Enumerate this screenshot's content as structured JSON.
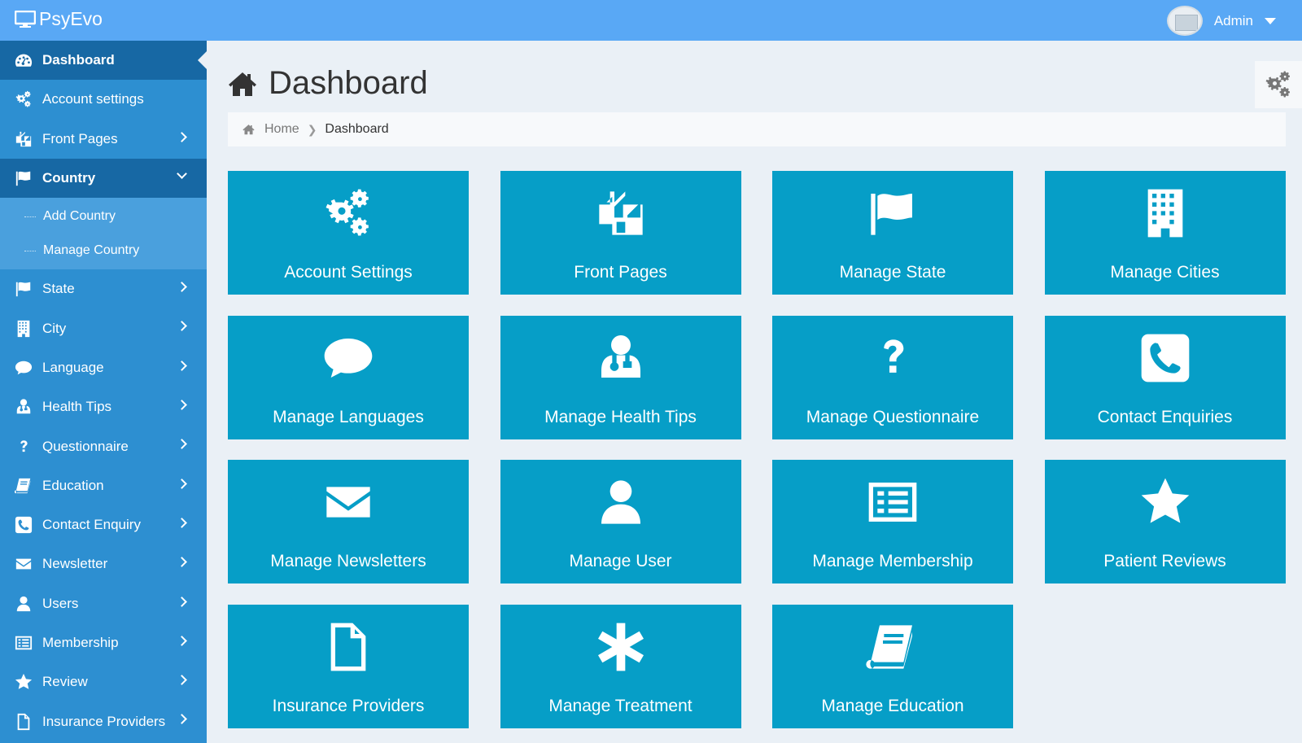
{
  "app": {
    "brand": "PsyEvo",
    "user": "Admin"
  },
  "sidebar": {
    "items": [
      {
        "label": "Dashboard"
      },
      {
        "label": "Account settings"
      },
      {
        "label": "Front Pages"
      },
      {
        "label": "Country"
      },
      {
        "label": "State"
      },
      {
        "label": "City"
      },
      {
        "label": "Language"
      },
      {
        "label": "Health Tips"
      },
      {
        "label": "Questionnaire"
      },
      {
        "label": "Education"
      },
      {
        "label": "Contact Enquiry"
      },
      {
        "label": "Newsletter"
      },
      {
        "label": "Users"
      },
      {
        "label": "Membership"
      },
      {
        "label": "Review"
      },
      {
        "label": "Insurance Providers"
      }
    ],
    "country_sub": [
      {
        "label": "Add Country"
      },
      {
        "label": "Manage Country"
      }
    ]
  },
  "page": {
    "title": "Dashboard"
  },
  "breadcrumb": {
    "home": "Home",
    "current": "Dashboard"
  },
  "tiles": [
    {
      "label": "Account Settings",
      "icon": "gears-icon"
    },
    {
      "label": "Front Pages",
      "icon": "copy-icon"
    },
    {
      "label": "Manage State",
      "icon": "flag-icon"
    },
    {
      "label": "Manage Cities",
      "icon": "building-icon"
    },
    {
      "label": "Manage Languages",
      "icon": "comment-icon"
    },
    {
      "label": "Manage Health Tips",
      "icon": "user-md-icon"
    },
    {
      "label": "Manage Questionnaire",
      "icon": "question-icon"
    },
    {
      "label": "Contact Enquiries",
      "icon": "phone-square-icon"
    },
    {
      "label": "Manage Newsletters",
      "icon": "envelope-icon"
    },
    {
      "label": "Manage User",
      "icon": "user-icon"
    },
    {
      "label": "Manage Membership",
      "icon": "list-alt-icon"
    },
    {
      "label": "Patient Reviews",
      "icon": "star-icon"
    },
    {
      "label": "Insurance Providers",
      "icon": "file-icon"
    },
    {
      "label": "Manage Treatment",
      "icon": "asterisk-icon"
    },
    {
      "label": "Manage Education",
      "icon": "book-icon"
    }
  ],
  "colors": {
    "topbar": "#59a8f5",
    "sidebar": "#2d8fd1",
    "sidebar_active": "#1768a4",
    "tile": "#069ec7"
  }
}
